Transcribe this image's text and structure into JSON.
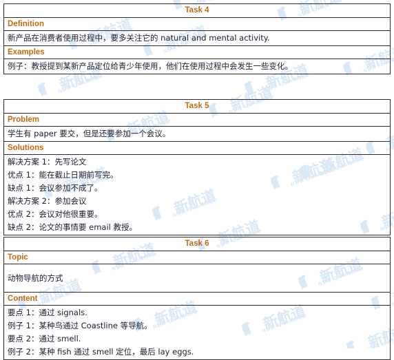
{
  "document": {
    "watermark": {
      "logo_text": "NC",
      "chinese": "新航道",
      "english": "NEW CHANNEL",
      "color": "#dbe9f7"
    },
    "colors": {
      "heading": "#c4690f",
      "body_text": "#1c1c30",
      "border": "#2b2b2b",
      "background": "#ffffff"
    }
  },
  "tasks": [
    {
      "id": "task4",
      "title": "Task 4",
      "sections": [
        {
          "heading": "Definition",
          "lines": [
            "新产品在消费者使用过程中，要多关注它的 natural and mental activity."
          ]
        },
        {
          "heading": "Examples",
          "lines": [
            "例子：教授提到某新产品定位给青少年使用，他们在使用过程中会发生一些变化。"
          ]
        }
      ]
    },
    {
      "id": "task5",
      "title": "Task 5",
      "sections": [
        {
          "heading": "Problem",
          "lines": [
            "学生有 paper 要交，但是还要参加一个会议。"
          ]
        },
        {
          "heading": "Solutions",
          "lines": [
            "解决方案 1：先写论文",
            "优点 1：能在截止日期前写完。",
            "缺点 1：会议参加不成了。",
            "解决方案 2：参加会议",
            "优点 2：会议对他很重要。",
            "缺点 2：论文的事情要 email 教授。"
          ]
        }
      ]
    },
    {
      "id": "task6",
      "title": "Task 6",
      "sections": [
        {
          "heading": "Topic",
          "lines": [
            "动物导航的方式"
          ]
        },
        {
          "heading": "Content",
          "lines": [
            "要点 1：通过 signals.",
            "例子 1：某种鸟通过 Coastline 等导航。",
            "要点 2：通过  smell.",
            "例子 2：某种 fish  通过 smell  定位，最后 lay eggs."
          ]
        }
      ]
    }
  ]
}
